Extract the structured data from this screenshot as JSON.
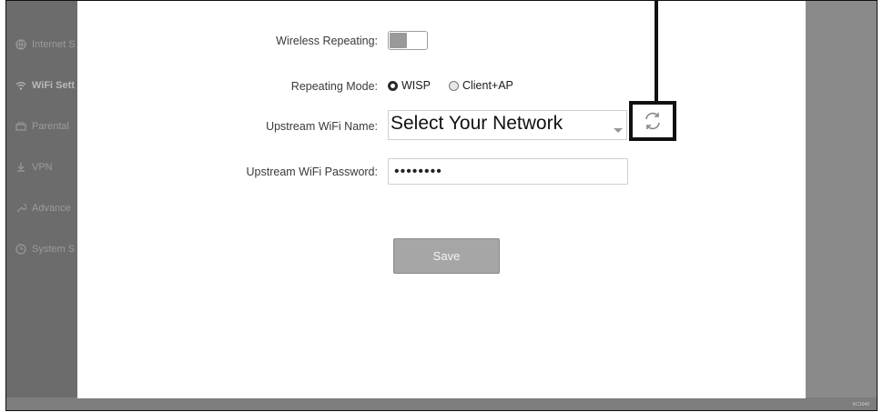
{
  "sidebar": {
    "items": [
      {
        "label": "Internet S",
        "icon": "globe-icon"
      },
      {
        "label": "WiFi Sett",
        "icon": "wifi-icon"
      },
      {
        "label": "Parental",
        "icon": "parental-icon"
      },
      {
        "label": "VPN",
        "icon": "vpn-icon"
      },
      {
        "label": "Advance",
        "icon": "wrench-icon"
      },
      {
        "label": "System S",
        "icon": "clock-icon"
      }
    ]
  },
  "form": {
    "wireless_repeating_label": "Wireless Repeating:",
    "repeating_mode_label": "Repeating Mode:",
    "repeating_mode_options": [
      "WISP",
      "Client+AP"
    ],
    "upstream_name_label": "Upstream WiFi Name:",
    "upstream_name_value": "Select Your Network",
    "upstream_password_label": "Upstream WiFi Password:",
    "upstream_password_value": "••••••••",
    "save_label": "Save"
  },
  "footer": {
    "code": "KC1040"
  },
  "colors": {
    "sidebar_bg": "#6c6c6c",
    "page_bg": "#8a8a8a",
    "callout": "#111111"
  }
}
